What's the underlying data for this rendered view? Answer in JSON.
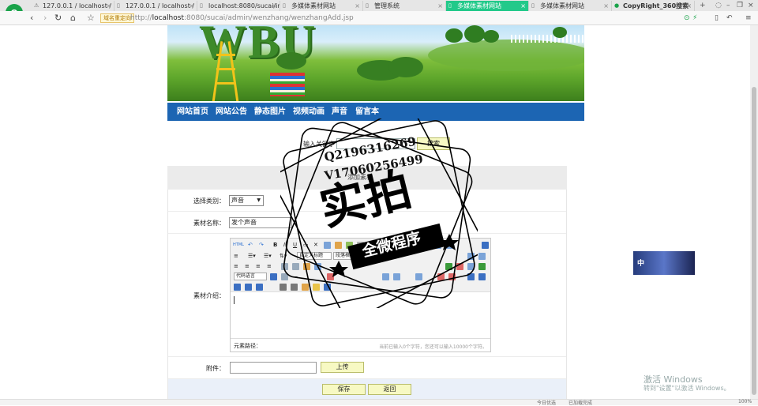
{
  "browser": {
    "logo_glyph": "e",
    "tabs": [
      {
        "title": "127.0.0.1 / localhost / db"
      },
      {
        "title": "127.0.0.1 / localhost / my"
      },
      {
        "title": "localhost:8080/sucai/inde"
      },
      {
        "title": "多媒体素材网站"
      },
      {
        "title": "管理系统"
      },
      {
        "title": "多媒体素材网站",
        "active": true
      },
      {
        "title": "多媒体素材网站"
      },
      {
        "title": "CopyRight_360搜索"
      }
    ],
    "new_tab": "+",
    "badge": "域名重定向",
    "url_host": "localhost",
    "url_rest": ":8080/sucai/admin/wenzhang/wenzhangAdd.jsp",
    "url_scheme": "http://"
  },
  "site_nav": [
    "网站首页",
    "网站公告",
    "静态图片",
    "视频动画",
    "声音",
    "留言本"
  ],
  "search": {
    "label": "输入关键字",
    "button": "搜索"
  },
  "form": {
    "header": "添加素材",
    "category_label": "选择类别：",
    "category_value": "声音",
    "name_label": "素材名称：",
    "name_value": "发个声音",
    "intro_label": "素材介绍：",
    "editor": {
      "heading_select": "自定义标题",
      "paragraph_select": "段落格式",
      "code_select": "代码语言",
      "path_label": "元素路径：",
      "counter": "当前已输入0个字符，您还可以输入10000个字符。"
    },
    "attach_label": "附件：",
    "upload_button": "上传",
    "save_button": "保存",
    "back_button": "返回"
  },
  "watermark": {
    "line1": "Q2196316269",
    "line2": "V17060256499",
    "big": "实拍",
    "band": "全微程序"
  },
  "float_widget": {
    "text": "中"
  },
  "windows": {
    "line1": "激活 Windows",
    "line2": "转到\"设置\"以激活 Windows。"
  },
  "status": [
    "今日优选",
    "已加载完成",
    "100%"
  ]
}
